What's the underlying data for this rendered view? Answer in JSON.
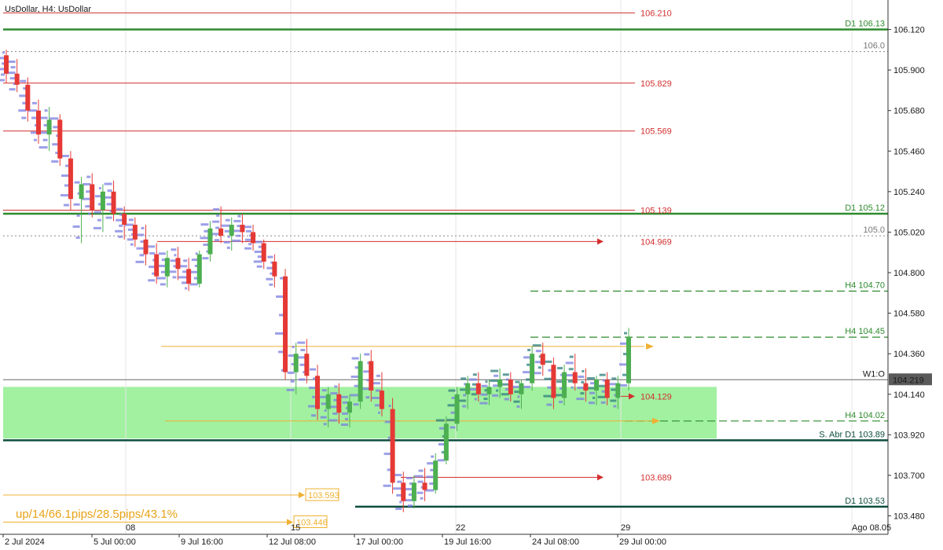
{
  "chart_title": "UsDollar, H4:  UsDollar",
  "stats_text": "up/14/66.1pips/28.5pips/43.1%",
  "colors": {
    "bull": "#4caf50",
    "bear": "#e53935",
    "zone": "#90ee90",
    "profile": "#7b7fe0",
    "profile_dark": "#2e7d7d",
    "level_red": "#d32f2f",
    "level_green": "#2e8b2e",
    "level_dark": "#0d4d3d",
    "orange": "#f0b030"
  },
  "chart_data": {
    "type": "candlestick",
    "symbol": "UsDollar",
    "timeframe": "H4",
    "ylim": [
      103.38,
      106.28
    ],
    "y_ticks": [
      106.12,
      105.9,
      105.68,
      105.46,
      105.24,
      105.02,
      104.8,
      104.58,
      104.36,
      104.14,
      103.92,
      103.7,
      103.48
    ],
    "x_ticks": [
      "2 Jul 2024",
      "5 Jul 00:00",
      "9 Jul 16:00",
      "12 Jul 08:00",
      "17 Jul 00:00",
      "19 Jul 16:00",
      "24 Jul 08:00",
      "29 Jul 00:00"
    ],
    "period_markers": [
      "08",
      "15",
      "22",
      "29",
      "Ago 08.05"
    ],
    "current_price": "104.219",
    "demand_zone": {
      "top": 104.18,
      "bottom": 103.9
    },
    "levels": [
      {
        "label": "106.210",
        "value": 106.21,
        "kind": "red-thin"
      },
      {
        "label": "D1 106.13",
        "value": 106.12,
        "kind": "green-thick"
      },
      {
        "label": "106.0",
        "value": 106.0,
        "kind": "gray-dotted"
      },
      {
        "label": "105.829",
        "value": 105.829,
        "kind": "red-thin"
      },
      {
        "label": "105.569",
        "value": 105.569,
        "kind": "red-thin"
      },
      {
        "label": "105.139",
        "value": 105.139,
        "kind": "red-thin"
      },
      {
        "label": "D1 105.12",
        "value": 105.12,
        "kind": "green-thick"
      },
      {
        "label": "105.0",
        "value": 105.0,
        "kind": "gray-dotted"
      },
      {
        "label": "104.969",
        "value": 104.969,
        "kind": "red-arrow"
      },
      {
        "label": "H4 104.70",
        "value": 104.7,
        "kind": "green-dashed"
      },
      {
        "label": "H4 104.45",
        "value": 104.45,
        "kind": "green-dashed"
      },
      {
        "label": "W1:O",
        "value": 104.219,
        "kind": "gray-thin"
      },
      {
        "label": "104.129",
        "value": 104.129,
        "kind": "red-arrow"
      },
      {
        "label": "H4 104.02",
        "value": 103.995,
        "kind": "green-dashed"
      },
      {
        "label": "S. Abr D1 103.89",
        "value": 103.89,
        "kind": "dark-thick"
      },
      {
        "label": "103.689",
        "value": 103.689,
        "kind": "red-arrow"
      },
      {
        "label": "103.593",
        "value": 103.593,
        "kind": "orange-arrow"
      },
      {
        "label": "D1 103.53",
        "value": 103.53,
        "kind": "dark-thick"
      },
      {
        "label": "103.446",
        "value": 103.446,
        "kind": "orange-arrow"
      }
    ],
    "candles": [
      {
        "o": 105.98,
        "h": 106.01,
        "l": 105.83,
        "c": 105.88
      },
      {
        "o": 105.88,
        "h": 105.96,
        "l": 105.78,
        "c": 105.82
      },
      {
        "o": 105.82,
        "h": 105.86,
        "l": 105.62,
        "c": 105.68
      },
      {
        "o": 105.68,
        "h": 105.74,
        "l": 105.5,
        "c": 105.55
      },
      {
        "o": 105.55,
        "h": 105.7,
        "l": 105.46,
        "c": 105.63
      },
      {
        "o": 105.63,
        "h": 105.66,
        "l": 105.38,
        "c": 105.42
      },
      {
        "o": 105.42,
        "h": 105.46,
        "l": 105.14,
        "c": 105.2
      },
      {
        "o": 105.2,
        "h": 105.32,
        "l": 104.96,
        "c": 105.28
      },
      {
        "o": 105.28,
        "h": 105.34,
        "l": 105.1,
        "c": 105.14
      },
      {
        "o": 105.14,
        "h": 105.28,
        "l": 105.02,
        "c": 105.24
      },
      {
        "o": 105.24,
        "h": 105.3,
        "l": 105.08,
        "c": 105.12
      },
      {
        "o": 105.12,
        "h": 105.16,
        "l": 104.98,
        "c": 105.06
      },
      {
        "o": 105.06,
        "h": 105.1,
        "l": 104.94,
        "c": 104.98
      },
      {
        "o": 104.98,
        "h": 105.06,
        "l": 104.84,
        "c": 104.9
      },
      {
        "o": 104.9,
        "h": 104.96,
        "l": 104.74,
        "c": 104.78
      },
      {
        "o": 104.78,
        "h": 104.92,
        "l": 104.72,
        "c": 104.88
      },
      {
        "o": 104.88,
        "h": 104.94,
        "l": 104.76,
        "c": 104.82
      },
      {
        "o": 104.82,
        "h": 104.88,
        "l": 104.7,
        "c": 104.74
      },
      {
        "o": 104.74,
        "h": 104.92,
        "l": 104.72,
        "c": 104.9
      },
      {
        "o": 104.9,
        "h": 105.08,
        "l": 104.86,
        "c": 105.04
      },
      {
        "o": 105.04,
        "h": 105.16,
        "l": 104.96,
        "c": 105.0
      },
      {
        "o": 105.0,
        "h": 105.1,
        "l": 104.92,
        "c": 105.06
      },
      {
        "o": 105.06,
        "h": 105.12,
        "l": 104.96,
        "c": 105.02
      },
      {
        "o": 105.02,
        "h": 105.06,
        "l": 104.92,
        "c": 104.96
      },
      {
        "o": 104.96,
        "h": 104.98,
        "l": 104.82,
        "c": 104.86
      },
      {
        "o": 104.86,
        "h": 104.9,
        "l": 104.72,
        "c": 104.78
      },
      {
        "o": 104.78,
        "h": 104.82,
        "l": 104.22,
        "c": 104.26
      },
      {
        "o": 104.26,
        "h": 104.42,
        "l": 104.14,
        "c": 104.36
      },
      {
        "o": 104.36,
        "h": 104.44,
        "l": 104.2,
        "c": 104.24
      },
      {
        "o": 104.24,
        "h": 104.3,
        "l": 104.0,
        "c": 104.06
      },
      {
        "o": 104.06,
        "h": 104.18,
        "l": 103.96,
        "c": 104.14
      },
      {
        "o": 104.14,
        "h": 104.2,
        "l": 103.98,
        "c": 104.04
      },
      {
        "o": 104.04,
        "h": 104.14,
        "l": 103.96,
        "c": 104.1
      },
      {
        "o": 104.1,
        "h": 104.36,
        "l": 104.06,
        "c": 104.32
      },
      {
        "o": 104.32,
        "h": 104.38,
        "l": 104.1,
        "c": 104.16
      },
      {
        "o": 104.16,
        "h": 104.26,
        "l": 104.02,
        "c": 104.06
      },
      {
        "o": 104.06,
        "h": 104.12,
        "l": 103.6,
        "c": 103.66
      },
      {
        "o": 103.66,
        "h": 103.72,
        "l": 103.5,
        "c": 103.56
      },
      {
        "o": 103.56,
        "h": 103.7,
        "l": 103.52,
        "c": 103.66
      },
      {
        "o": 103.66,
        "h": 103.74,
        "l": 103.56,
        "c": 103.62
      },
      {
        "o": 103.62,
        "h": 103.82,
        "l": 103.6,
        "c": 103.78
      },
      {
        "o": 103.78,
        "h": 104.02,
        "l": 103.76,
        "c": 103.98
      },
      {
        "o": 103.98,
        "h": 104.18,
        "l": 103.94,
        "c": 104.14
      },
      {
        "o": 104.14,
        "h": 104.24,
        "l": 104.06,
        "c": 104.2
      },
      {
        "o": 104.2,
        "h": 104.26,
        "l": 104.1,
        "c": 104.14
      },
      {
        "o": 104.14,
        "h": 104.22,
        "l": 104.08,
        "c": 104.18
      },
      {
        "o": 104.18,
        "h": 104.28,
        "l": 104.12,
        "c": 104.22
      },
      {
        "o": 104.22,
        "h": 104.26,
        "l": 104.1,
        "c": 104.14
      },
      {
        "o": 104.14,
        "h": 104.22,
        "l": 104.06,
        "c": 104.2
      },
      {
        "o": 104.2,
        "h": 104.4,
        "l": 104.16,
        "c": 104.36
      },
      {
        "o": 104.36,
        "h": 104.42,
        "l": 104.24,
        "c": 104.3
      },
      {
        "o": 104.3,
        "h": 104.34,
        "l": 104.06,
        "c": 104.12
      },
      {
        "o": 104.12,
        "h": 104.3,
        "l": 104.08,
        "c": 104.26
      },
      {
        "o": 104.26,
        "h": 104.36,
        "l": 104.16,
        "c": 104.2
      },
      {
        "o": 104.2,
        "h": 104.28,
        "l": 104.1,
        "c": 104.16
      },
      {
        "o": 104.16,
        "h": 104.24,
        "l": 104.08,
        "c": 104.22
      },
      {
        "o": 104.22,
        "h": 104.26,
        "l": 104.08,
        "c": 104.12
      },
      {
        "o": 104.12,
        "h": 104.24,
        "l": 104.06,
        "c": 104.2
      },
      {
        "o": 104.2,
        "h": 104.5,
        "l": 104.16,
        "c": 104.45
      }
    ]
  }
}
